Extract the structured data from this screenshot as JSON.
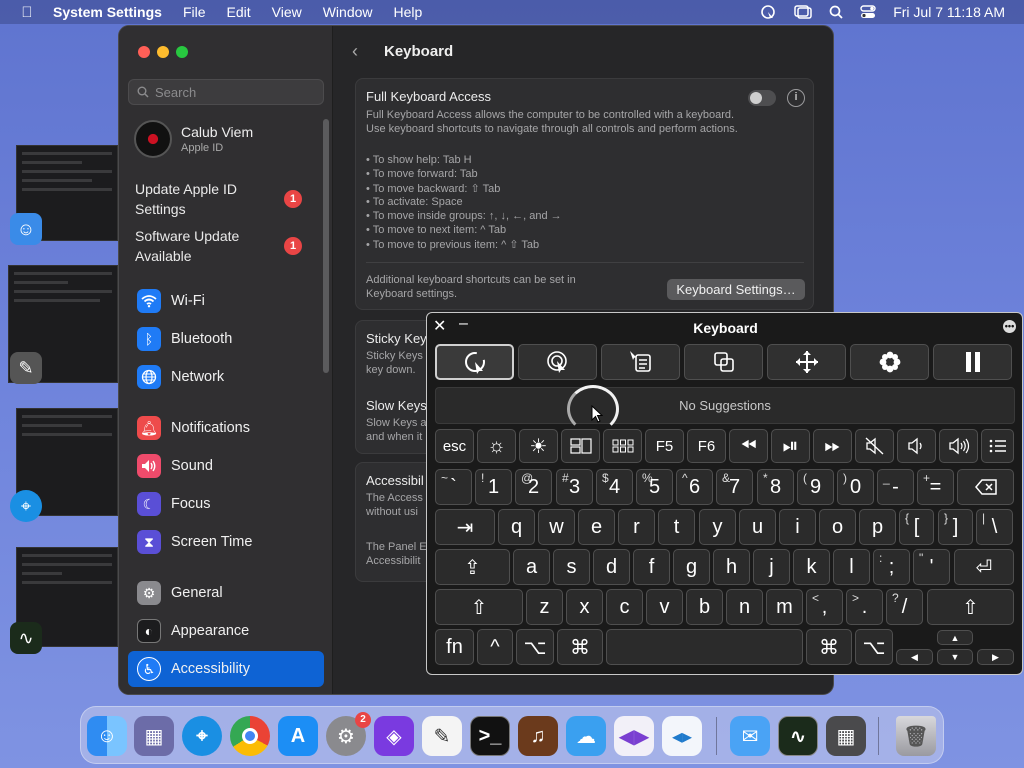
{
  "menubar": {
    "app": "System Settings",
    "items": [
      "File",
      "Edit",
      "View",
      "Window",
      "Help"
    ],
    "datetime": "Fri Jul 7  11:18 AM"
  },
  "sidebar": {
    "search_placeholder": "Search",
    "user": {
      "name": "Calub Viem",
      "sub": "Apple ID"
    },
    "alerts": [
      {
        "line1": "Update Apple ID",
        "line2": "Settings",
        "badge": "1"
      },
      {
        "line1": "Software Update",
        "line2": "Available",
        "badge": "1"
      }
    ],
    "items": [
      {
        "label": "Wi-Fi",
        "icon": "wifi-icon",
        "color": "#1f7bf6"
      },
      {
        "label": "Bluetooth",
        "icon": "bluetooth-icon",
        "color": "#1f7bf6"
      },
      {
        "label": "Network",
        "icon": "globe-icon",
        "color": "#1f7bf6"
      },
      {
        "label": "Notifications",
        "icon": "bell-icon",
        "color": "#ee4b4b"
      },
      {
        "label": "Sound",
        "icon": "speaker-icon",
        "color": "#ee4b6b"
      },
      {
        "label": "Focus",
        "icon": "moon-icon",
        "color": "#5a4fd6"
      },
      {
        "label": "Screen Time",
        "icon": "hourglass-icon",
        "color": "#5a4fd6"
      },
      {
        "label": "General",
        "icon": "gear-icon",
        "color": "#8a8a8e"
      },
      {
        "label": "Appearance",
        "icon": "appearance-icon",
        "color": "#1c1c1e"
      },
      {
        "label": "Accessibility",
        "icon": "accessibility-icon",
        "color": "#1f7bf6"
      }
    ]
  },
  "content": {
    "title": "Keyboard",
    "fka": {
      "title": "Full Keyboard Access",
      "description": "Full Keyboard Access allows the computer to be controlled with a keyboard. Use keyboard shortcuts to navigate through all controls and perform actions.",
      "bullets": [
        "• To show help: Tab H",
        "• To move forward: Tab",
        "• To move backward: ⇧ Tab",
        "• To activate: Space",
        "• To move inside groups: ↑, ↓, ←, and →",
        "• To move to next item: ^ Tab",
        "• To move to previous item: ^ ⇧ Tab"
      ],
      "more_line1": "Additional keyboard shortcuts can be set in",
      "more_line2": "Keyboard settings.",
      "button": "Keyboard Settings…"
    },
    "sticky": {
      "title": "Sticky Key",
      "line1": "Sticky Keys",
      "line2": "key down."
    },
    "slow": {
      "title": "Slow Keys",
      "line1": "Slow Keys a",
      "line2": "and when it"
    },
    "acc": {
      "title": "Accessibil",
      "line1": "The Access",
      "line2": "without usi",
      "line3": "The Panel E",
      "line4": "Accessibilit"
    }
  },
  "keyboard_viewer": {
    "title": "Keyboard",
    "suggestions": "No Suggestions",
    "fn_labels": [
      "esc",
      "F5",
      "F6"
    ],
    "rows": {
      "num": [
        [
          "~",
          "`"
        ],
        [
          "!",
          "1"
        ],
        [
          "@",
          "2"
        ],
        [
          "#",
          "3"
        ],
        [
          "$",
          "4"
        ],
        [
          "%",
          "5"
        ],
        [
          "^",
          "6"
        ],
        [
          "&",
          "7"
        ],
        [
          "*",
          "8"
        ],
        [
          "(",
          "9"
        ],
        [
          ")",
          "0"
        ],
        [
          "_",
          "-"
        ],
        [
          "+",
          "="
        ]
      ],
      "q": [
        "q",
        "w",
        "e",
        "r",
        "t",
        "y",
        "u",
        "i",
        "o",
        "p"
      ],
      "q_end": [
        [
          "{",
          "["
        ],
        [
          "}",
          "]"
        ],
        [
          "|",
          "\\"
        ]
      ],
      "a": [
        "a",
        "s",
        "d",
        "f",
        "g",
        "h",
        "j",
        "k",
        "l"
      ],
      "a_end": [
        [
          ":",
          ";"
        ],
        [
          "\"",
          "'"
        ]
      ],
      "z": [
        "z",
        "x",
        "c",
        "v",
        "b",
        "n",
        "m"
      ],
      "z_end": [
        [
          "<",
          ","
        ],
        [
          ">",
          "."
        ],
        [
          "?",
          "/"
        ]
      ]
    },
    "mods": {
      "fn": "fn",
      "ctrl": "^",
      "opt": "⌥",
      "cmd": "⌘"
    }
  },
  "dock": {
    "settings_badge": "2"
  }
}
